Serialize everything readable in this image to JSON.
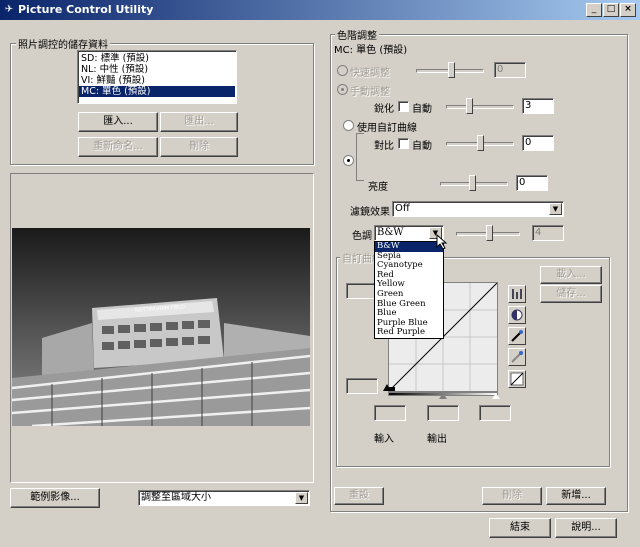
{
  "window": {
    "title": "Picture Control Utility",
    "minimize": "_",
    "maximize": "□",
    "close": "×"
  },
  "storage": {
    "label": "照片調控的儲存資料",
    "items": [
      "SD: 標準 (預設)",
      "NL: 中性 (預設)",
      "VI: 鮮豔 (預設)",
      "MC: 單色 (預設)"
    ],
    "import_btn": "匯入...",
    "export_btn": "匯出...",
    "rename_btn": "重新命名...",
    "delete_btn": "刪除"
  },
  "preview": {
    "building_sign": "NOTTINGHAM FIELD",
    "sample_btn": "範例影像...",
    "fit_select": "調整至區域大小"
  },
  "adjust": {
    "group_label": "色階調整",
    "current": "MC: 單色 (預設)",
    "quick_label": "快速調整",
    "quick_value": "0",
    "manual_label": "手動調整",
    "sharpen_label": "銳化",
    "auto_label": "自動",
    "sharpen_value": "3",
    "custom_curve_label": "使用自訂曲線",
    "contrast_label": "對比",
    "contrast_value": "0",
    "brightness_label": "亮度",
    "brightness_value": "0",
    "filter_label": "濾鏡效果",
    "filter_value": "Off",
    "toning_label": "色調",
    "toning_value": "B&W",
    "toning_strength": "4",
    "toning_options": [
      "B&W",
      "Sepia",
      "Cyanotype",
      "Red",
      "Yellow",
      "Green",
      "Blue Green",
      "Blue",
      "Purple Blue",
      "Red Purple"
    ]
  },
  "curve": {
    "group_label": "自訂曲線",
    "load_btn": "載入...",
    "save_btn": "儲存...",
    "input_label": "輸入",
    "output_label": "輸出"
  },
  "footer": {
    "reset_btn": "重設",
    "delete_btn": "刪除",
    "new_btn": "新增...",
    "end_btn": "結束",
    "help_btn": "說明..."
  },
  "colors": {
    "titlebar_start": "#0a246a",
    "titlebar_end": "#a6caf0",
    "selection": "#0a246a",
    "face": "#d4d0c8"
  }
}
